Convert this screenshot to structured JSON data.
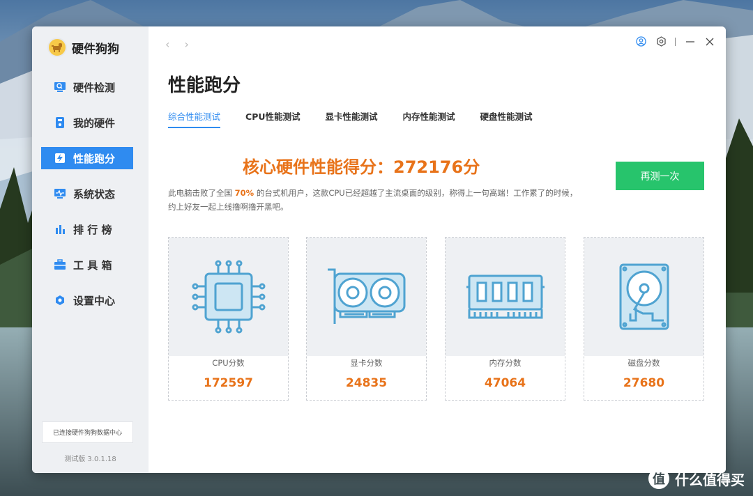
{
  "app": {
    "name": "硬件狗狗"
  },
  "sidebar": {
    "items": [
      {
        "label": "硬件检测",
        "icon": "monitor-search-icon"
      },
      {
        "label": "我的硬件",
        "icon": "device-icon"
      },
      {
        "label": "性能跑分",
        "icon": "lightning-icon",
        "active": true
      },
      {
        "label": "系统状态",
        "icon": "pulse-icon"
      },
      {
        "label": "排 行 榜",
        "icon": "bar-chart-icon"
      },
      {
        "label": "工 具 箱",
        "icon": "toolbox-icon"
      },
      {
        "label": "设置中心",
        "icon": "settings-hex-icon"
      }
    ],
    "connection_status": "已连接硬件狗狗数据中心",
    "version": "测试版 3.0.1.18"
  },
  "header": {
    "back": "‹",
    "forward": "›",
    "page_title": "性能跑分"
  },
  "tabs": [
    {
      "label": "综合性能测试",
      "active": true
    },
    {
      "label": "CPU性能测试"
    },
    {
      "label": "显卡性能测试"
    },
    {
      "label": "内存性能测试"
    },
    {
      "label": "硬盘性能测试"
    }
  ],
  "summary": {
    "headline": "核心硬件性能得分：272176分",
    "retest_label": "再测一次",
    "desc_before": "此电脑击败了全国 ",
    "desc_percent": "70%",
    "desc_after": " 的台式机用户，这款CPU已经超越了主流桌面的级别，称得上一句高端！工作累了的时候，约上好友一起上线撸啊撸开黑吧。"
  },
  "scores": [
    {
      "label": "CPU分数",
      "value": "172597",
      "icon": "cpu-icon"
    },
    {
      "label": "显卡分数",
      "value": "24835",
      "icon": "gpu-icon"
    },
    {
      "label": "内存分数",
      "value": "47064",
      "icon": "ram-icon"
    },
    {
      "label": "磁盘分数",
      "value": "27680",
      "icon": "hdd-icon"
    }
  ],
  "watermark": {
    "glyph": "值",
    "text": "什么值得买"
  },
  "colors": {
    "accent": "#2f8bf0",
    "score": "#e8731a",
    "retest": "#27c46c"
  }
}
